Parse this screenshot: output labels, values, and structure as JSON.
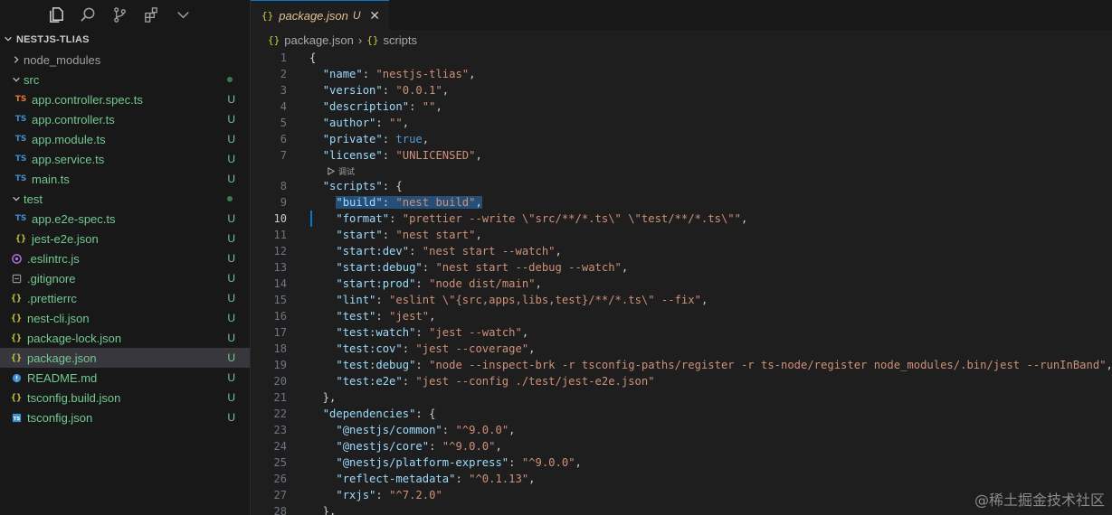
{
  "sidebar": {
    "activity_icons": [
      "files-icon",
      "search-icon",
      "source-control-icon",
      "extensions-icon",
      "chevron-down-icon"
    ],
    "project_name": "NESTJS-TLIAS",
    "tree": [
      {
        "name": "node_modules",
        "kind": "folder",
        "expanded": false,
        "depth": 0,
        "color": "gray"
      },
      {
        "name": "src",
        "kind": "folder",
        "expanded": true,
        "depth": 0,
        "color": "green",
        "dot": true
      },
      {
        "name": "app.controller.spec.ts",
        "kind": "ts-orange",
        "depth": 1,
        "color": "green",
        "badge": "U"
      },
      {
        "name": "app.controller.ts",
        "kind": "ts",
        "depth": 1,
        "color": "green",
        "badge": "U"
      },
      {
        "name": "app.module.ts",
        "kind": "ts",
        "depth": 1,
        "color": "green",
        "badge": "U"
      },
      {
        "name": "app.service.ts",
        "kind": "ts",
        "depth": 1,
        "color": "green",
        "badge": "U"
      },
      {
        "name": "main.ts",
        "kind": "ts",
        "depth": 1,
        "color": "green",
        "badge": "U"
      },
      {
        "name": "test",
        "kind": "folder",
        "expanded": true,
        "depth": 0,
        "color": "green",
        "dot": true
      },
      {
        "name": "app.e2e-spec.ts",
        "kind": "ts",
        "depth": 1,
        "color": "green",
        "badge": "U"
      },
      {
        "name": "jest-e2e.json",
        "kind": "json",
        "depth": 1,
        "color": "green",
        "badge": "U"
      },
      {
        "name": ".eslintrc.js",
        "kind": "eslint",
        "depth": 0,
        "color": "green",
        "badge": "U"
      },
      {
        "name": ".gitignore",
        "kind": "gitignore",
        "depth": 0,
        "color": "green",
        "badge": "U"
      },
      {
        "name": ".prettierrc",
        "kind": "json",
        "depth": 0,
        "color": "green",
        "badge": "U"
      },
      {
        "name": "nest-cli.json",
        "kind": "json",
        "depth": 0,
        "color": "green",
        "badge": "U"
      },
      {
        "name": "package-lock.json",
        "kind": "json",
        "depth": 0,
        "color": "green",
        "badge": "U"
      },
      {
        "name": "package.json",
        "kind": "json",
        "depth": 0,
        "color": "green",
        "badge": "U",
        "selected": true
      },
      {
        "name": "README.md",
        "kind": "md",
        "depth": 0,
        "color": "green",
        "badge": "U"
      },
      {
        "name": "tsconfig.build.json",
        "kind": "json",
        "depth": 0,
        "color": "green",
        "badge": "U"
      },
      {
        "name": "tsconfig.json",
        "kind": "tsconfig",
        "depth": 0,
        "color": "green",
        "badge": "U"
      }
    ]
  },
  "tab": {
    "icon": "{}",
    "name": "package.json",
    "status": "U",
    "close": "✕"
  },
  "breadcrumb": {
    "icon1": "{}",
    "file": "package.json",
    "sep": "›",
    "icon2": "{}",
    "item": "scripts"
  },
  "codelens": {
    "label": "调试"
  },
  "active_line": 10,
  "code_lines": [
    {
      "n": 1,
      "tokens": [
        [
          "brace",
          "{"
        ]
      ]
    },
    {
      "n": 2,
      "tokens": [
        [
          "p",
          "  "
        ],
        [
          "k",
          "\"name\""
        ],
        [
          "p",
          ": "
        ],
        [
          "s",
          "\"nestjs-tlias\""
        ],
        [
          "p",
          ","
        ]
      ]
    },
    {
      "n": 3,
      "tokens": [
        [
          "p",
          "  "
        ],
        [
          "k",
          "\"version\""
        ],
        [
          "p",
          ": "
        ],
        [
          "s",
          "\"0.0.1\""
        ],
        [
          "p",
          ","
        ]
      ]
    },
    {
      "n": 4,
      "tokens": [
        [
          "p",
          "  "
        ],
        [
          "k",
          "\"description\""
        ],
        [
          "p",
          ": "
        ],
        [
          "s",
          "\"\""
        ],
        [
          "p",
          ","
        ]
      ]
    },
    {
      "n": 5,
      "tokens": [
        [
          "p",
          "  "
        ],
        [
          "k",
          "\"author\""
        ],
        [
          "p",
          ": "
        ],
        [
          "s",
          "\"\""
        ],
        [
          "p",
          ","
        ]
      ]
    },
    {
      "n": 6,
      "tokens": [
        [
          "p",
          "  "
        ],
        [
          "k",
          "\"private\""
        ],
        [
          "p",
          ": "
        ],
        [
          "b",
          "true"
        ],
        [
          "p",
          ","
        ]
      ]
    },
    {
      "n": 7,
      "tokens": [
        [
          "p",
          "  "
        ],
        [
          "k",
          "\"license\""
        ],
        [
          "p",
          ": "
        ],
        [
          "s",
          "\"UNLICENSED\""
        ],
        [
          "p",
          ","
        ]
      ],
      "codelens_after": true
    },
    {
      "n": 8,
      "tokens": [
        [
          "p",
          "  "
        ],
        [
          "k",
          "\"scripts\""
        ],
        [
          "p",
          ": {"
        ]
      ]
    },
    {
      "n": 9,
      "tokens": [
        [
          "p",
          "    "
        ],
        [
          "k",
          "\"build\""
        ],
        [
          "p",
          ": "
        ],
        [
          "s",
          "\"nest build\""
        ],
        [
          "p",
          ","
        ]
      ],
      "highlight": true
    },
    {
      "n": 10,
      "tokens": [
        [
          "p",
          "    "
        ],
        [
          "k",
          "\"format\""
        ],
        [
          "p",
          ": "
        ],
        [
          "s",
          "\"prettier --write \\\"src/**/*.ts\\\" \\\"test/**/*.ts\\\"\""
        ],
        [
          "p",
          ","
        ]
      ]
    },
    {
      "n": 11,
      "tokens": [
        [
          "p",
          "    "
        ],
        [
          "k",
          "\"start\""
        ],
        [
          "p",
          ": "
        ],
        [
          "s",
          "\"nest start\""
        ],
        [
          "p",
          ","
        ]
      ]
    },
    {
      "n": 12,
      "tokens": [
        [
          "p",
          "    "
        ],
        [
          "k",
          "\"start:dev\""
        ],
        [
          "p",
          ": "
        ],
        [
          "s",
          "\"nest start --watch\""
        ],
        [
          "p",
          ","
        ]
      ]
    },
    {
      "n": 13,
      "tokens": [
        [
          "p",
          "    "
        ],
        [
          "k",
          "\"start:debug\""
        ],
        [
          "p",
          ": "
        ],
        [
          "s",
          "\"nest start --debug --watch\""
        ],
        [
          "p",
          ","
        ]
      ]
    },
    {
      "n": 14,
      "tokens": [
        [
          "p",
          "    "
        ],
        [
          "k",
          "\"start:prod\""
        ],
        [
          "p",
          ": "
        ],
        [
          "s",
          "\"node dist/main\""
        ],
        [
          "p",
          ","
        ]
      ]
    },
    {
      "n": 15,
      "tokens": [
        [
          "p",
          "    "
        ],
        [
          "k",
          "\"lint\""
        ],
        [
          "p",
          ": "
        ],
        [
          "s",
          "\"eslint \\\"{src,apps,libs,test}/**/*.ts\\\" --fix\""
        ],
        [
          "p",
          ","
        ]
      ]
    },
    {
      "n": 16,
      "tokens": [
        [
          "p",
          "    "
        ],
        [
          "k",
          "\"test\""
        ],
        [
          "p",
          ": "
        ],
        [
          "s",
          "\"jest\""
        ],
        [
          "p",
          ","
        ]
      ]
    },
    {
      "n": 17,
      "tokens": [
        [
          "p",
          "    "
        ],
        [
          "k",
          "\"test:watch\""
        ],
        [
          "p",
          ": "
        ],
        [
          "s",
          "\"jest --watch\""
        ],
        [
          "p",
          ","
        ]
      ]
    },
    {
      "n": 18,
      "tokens": [
        [
          "p",
          "    "
        ],
        [
          "k",
          "\"test:cov\""
        ],
        [
          "p",
          ": "
        ],
        [
          "s",
          "\"jest --coverage\""
        ],
        [
          "p",
          ","
        ]
      ]
    },
    {
      "n": 19,
      "tokens": [
        [
          "p",
          "    "
        ],
        [
          "k",
          "\"test:debug\""
        ],
        [
          "p",
          ": "
        ],
        [
          "s",
          "\"node --inspect-brk -r tsconfig-paths/register -r ts-node/register node_modules/.bin/jest --runInBand\""
        ],
        [
          "p",
          ","
        ]
      ]
    },
    {
      "n": 20,
      "tokens": [
        [
          "p",
          "    "
        ],
        [
          "k",
          "\"test:e2e\""
        ],
        [
          "p",
          ": "
        ],
        [
          "s",
          "\"jest --config ./test/jest-e2e.json\""
        ]
      ]
    },
    {
      "n": 21,
      "tokens": [
        [
          "p",
          "  },"
        ]
      ]
    },
    {
      "n": 22,
      "tokens": [
        [
          "p",
          "  "
        ],
        [
          "k",
          "\"dependencies\""
        ],
        [
          "p",
          ": {"
        ]
      ]
    },
    {
      "n": 23,
      "tokens": [
        [
          "p",
          "    "
        ],
        [
          "k",
          "\"@nestjs/common\""
        ],
        [
          "p",
          ": "
        ],
        [
          "s",
          "\"^9.0.0\""
        ],
        [
          "p",
          ","
        ]
      ]
    },
    {
      "n": 24,
      "tokens": [
        [
          "p",
          "    "
        ],
        [
          "k",
          "\"@nestjs/core\""
        ],
        [
          "p",
          ": "
        ],
        [
          "s",
          "\"^9.0.0\""
        ],
        [
          "p",
          ","
        ]
      ]
    },
    {
      "n": 25,
      "tokens": [
        [
          "p",
          "    "
        ],
        [
          "k",
          "\"@nestjs/platform-express\""
        ],
        [
          "p",
          ": "
        ],
        [
          "s",
          "\"^9.0.0\""
        ],
        [
          "p",
          ","
        ]
      ]
    },
    {
      "n": 26,
      "tokens": [
        [
          "p",
          "    "
        ],
        [
          "k",
          "\"reflect-metadata\""
        ],
        [
          "p",
          ": "
        ],
        [
          "s",
          "\"^0.1.13\""
        ],
        [
          "p",
          ","
        ]
      ]
    },
    {
      "n": 27,
      "tokens": [
        [
          "p",
          "    "
        ],
        [
          "k",
          "\"rxjs\""
        ],
        [
          "p",
          ": "
        ],
        [
          "s",
          "\"^7.2.0\""
        ]
      ]
    },
    {
      "n": 28,
      "tokens": [
        [
          "p",
          "  },"
        ]
      ]
    }
  ],
  "watermark": "@稀土掘金技术社区"
}
